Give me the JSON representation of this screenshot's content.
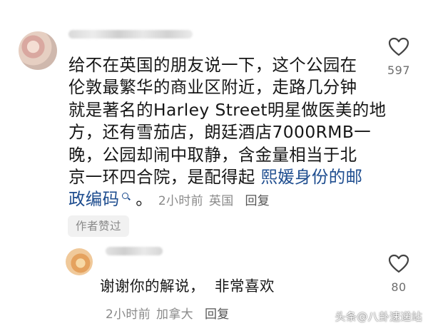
{
  "comment": {
    "lines": [
      "给不在英国的朋友说一下，这个公园在",
      "伦敦最繁华的商业区附近，走路几分钟",
      "就是著名的Harley Street明星做医美的地",
      "方，还有雪茄店，朗廷酒店7000RMB一",
      "晚，公园却闹中取静，含金量相当于北",
      "京一环四合院，是配得起"
    ],
    "link_text_1": "熙媛身份的邮",
    "link_text_2": "政编码",
    "after_link": "。",
    "time": "2小时前",
    "location": "英国",
    "reply_label": "回复",
    "author_liked_badge": "作者赞过",
    "like_count": "597"
  },
  "reply": {
    "text_1": "谢谢你的解说，",
    "text_2": "非常喜欢",
    "time": "2小时前",
    "location": "加拿大",
    "reply_label": "回复",
    "like_count": "80"
  },
  "watermark": "头条@八卦速递站",
  "icons": {
    "like": "heart-outline-icon",
    "search": "search-icon"
  },
  "colors": {
    "link": "#1e4d8f",
    "meta": "#8a8a8a"
  }
}
